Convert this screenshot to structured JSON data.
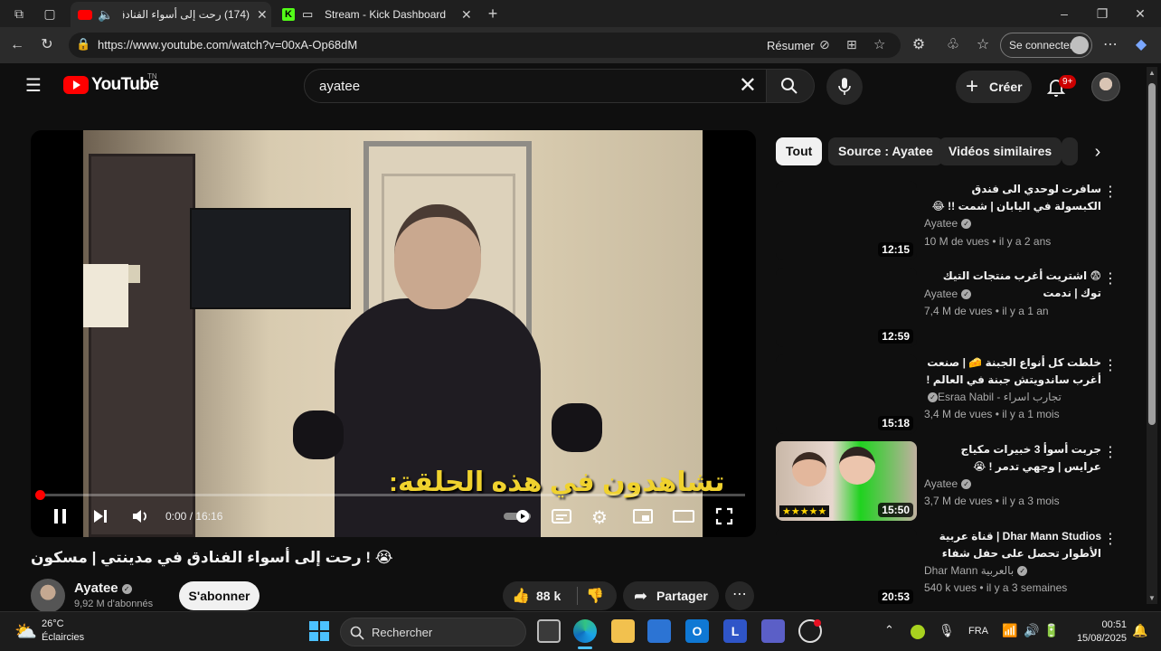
{
  "browser": {
    "tabs": [
      {
        "title": "(174) رحت إلى أسواء الفنادق و"
      },
      {
        "title": "Stream - Kick Dashboard"
      }
    ],
    "url": "https://www.youtube.com/watch?v=00xA-Op68dM",
    "resume_label": "Résumer",
    "signin_label": "Se connecter",
    "new_tab_icon": "plus-icon"
  },
  "youtube": {
    "logo_text": "YouTube",
    "logo_tm": "TN",
    "search_value": "ayatee",
    "create_label": "Créer",
    "notif_count": "9+"
  },
  "player": {
    "subtitle": "تشاهدون في هذه الحلقة:",
    "time": "0:00 / 16:16",
    "progress": 0.002
  },
  "video": {
    "title": "😭 ! رحت إلى أسواء الفنادق في مدينتي | مسكون",
    "channel": "Ayatee",
    "subscribers": "9,92 M d'abonnés",
    "subscribe_label": "S'abonner",
    "likes": "88 k",
    "share_label": "Partager"
  },
  "chips": [
    "Tout",
    "Source : Ayatee",
    "Vidéos similaires"
  ],
  "recommendations": [
    {
      "title": "سافرت لوحدي الى فندق الكبسولة في اليابان | شمت !! 😂",
      "channel": "Ayatee",
      "meta": "10 M de vues • il y a 2 ans",
      "duration": "12:15"
    },
    {
      "title": "😨 اشتريت أغرب منتجات التيك توك | ندمت",
      "channel": "Ayatee",
      "meta": "7,4 M de vues • il y a 1 an",
      "duration": "12:59"
    },
    {
      "title": "خلطت كل أنواع الجبنة 🧀 | صنعت أغرب ساندويتش جبنة في العالم ! 😱",
      "channel": "Esraa Nabil - تجارب اسراء",
      "meta": "3,4 M de vues • il y a 1 mois",
      "duration": "15:18"
    },
    {
      "title": "جربت أسوأ 3 خبيرات مكياج عرايس | وجهي تدمر ! 😭",
      "channel": "Ayatee",
      "meta": "3,7 M de vues • il y a 3 mois",
      "duration": "15:50"
    },
    {
      "title": "Dhar Mann Studios | قناة عربية الأطوار تحصل على حفل شفاء",
      "channel": "Dhar Mann بالعربية",
      "meta": "540 k vues • il y a 3 semaines",
      "duration": "20:53"
    }
  ],
  "taskbar": {
    "temperature": "26°C",
    "condition": "Éclaircies",
    "search_label": "Rechercher",
    "language": "FRA",
    "time": "00:51",
    "date": "15/08/2025"
  },
  "colors": {
    "youtube_red": "#ff0000",
    "subtitle_yellow": "#f0d22e",
    "kick_green": "#53fc18"
  }
}
